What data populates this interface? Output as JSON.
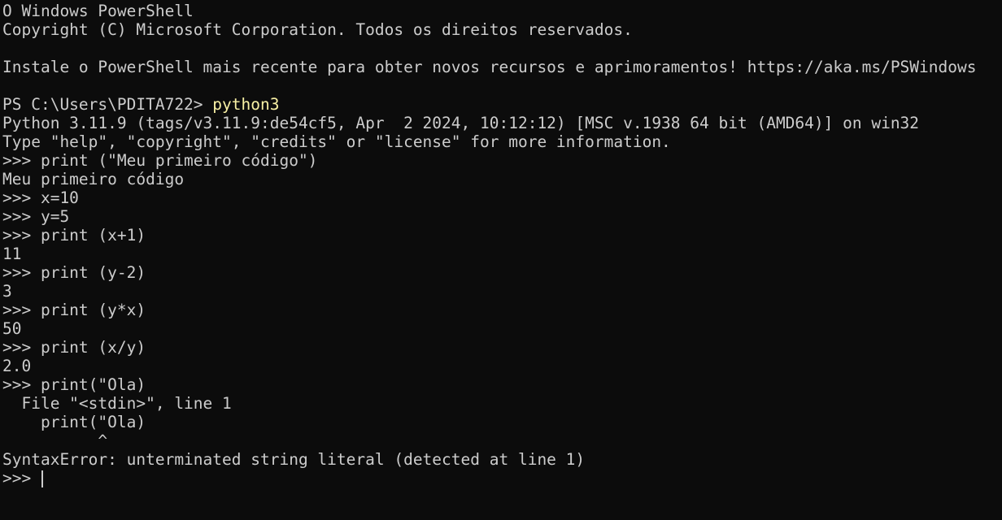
{
  "terminal": {
    "lines": [
      [
        {
          "t": "O Windows PowerShell"
        }
      ],
      [
        {
          "t": "Copyright (C) Microsoft Corporation. Todos os direitos reservados."
        }
      ],
      [
        {
          "t": ""
        }
      ],
      [
        {
          "t": "Instale o PowerShell mais recente para obter novos recursos e aprimoramentos! https://aka.ms/PSWindows"
        }
      ],
      [
        {
          "t": ""
        }
      ],
      [
        {
          "t": "PS C:\\Users\\PDITA722> "
        },
        {
          "t": "python3",
          "c": "cmd"
        }
      ],
      [
        {
          "t": "Python 3.11.9 (tags/v3.11.9:de54cf5, Apr  2 2024, 10:12:12) [MSC v.1938 64 bit (AMD64)] on win32"
        }
      ],
      [
        {
          "t": "Type \"help\", \"copyright\", \"credits\" or \"license\" for more information."
        }
      ],
      [
        {
          "t": ">>> print (\"Meu primeiro código\")"
        }
      ],
      [
        {
          "t": "Meu primeiro código"
        }
      ],
      [
        {
          "t": ">>> x=10"
        }
      ],
      [
        {
          "t": ">>> y=5"
        }
      ],
      [
        {
          "t": ">>> print (x+1)"
        }
      ],
      [
        {
          "t": "11"
        }
      ],
      [
        {
          "t": ">>> print (y-2)"
        }
      ],
      [
        {
          "t": "3"
        }
      ],
      [
        {
          "t": ">>> print (y*x)"
        }
      ],
      [
        {
          "t": "50"
        }
      ],
      [
        {
          "t": ">>> print (x/y)"
        }
      ],
      [
        {
          "t": "2.0"
        }
      ],
      [
        {
          "t": ">>> print(\"Ola)"
        }
      ],
      [
        {
          "t": "  File \"<stdin>\", line 1"
        }
      ],
      [
        {
          "t": "    print(\"Ola)"
        }
      ],
      [
        {
          "t": "          ^"
        }
      ],
      [
        {
          "t": "SyntaxError: unterminated string literal (detected at line 1)"
        }
      ]
    ],
    "prompt": ">>> "
  }
}
